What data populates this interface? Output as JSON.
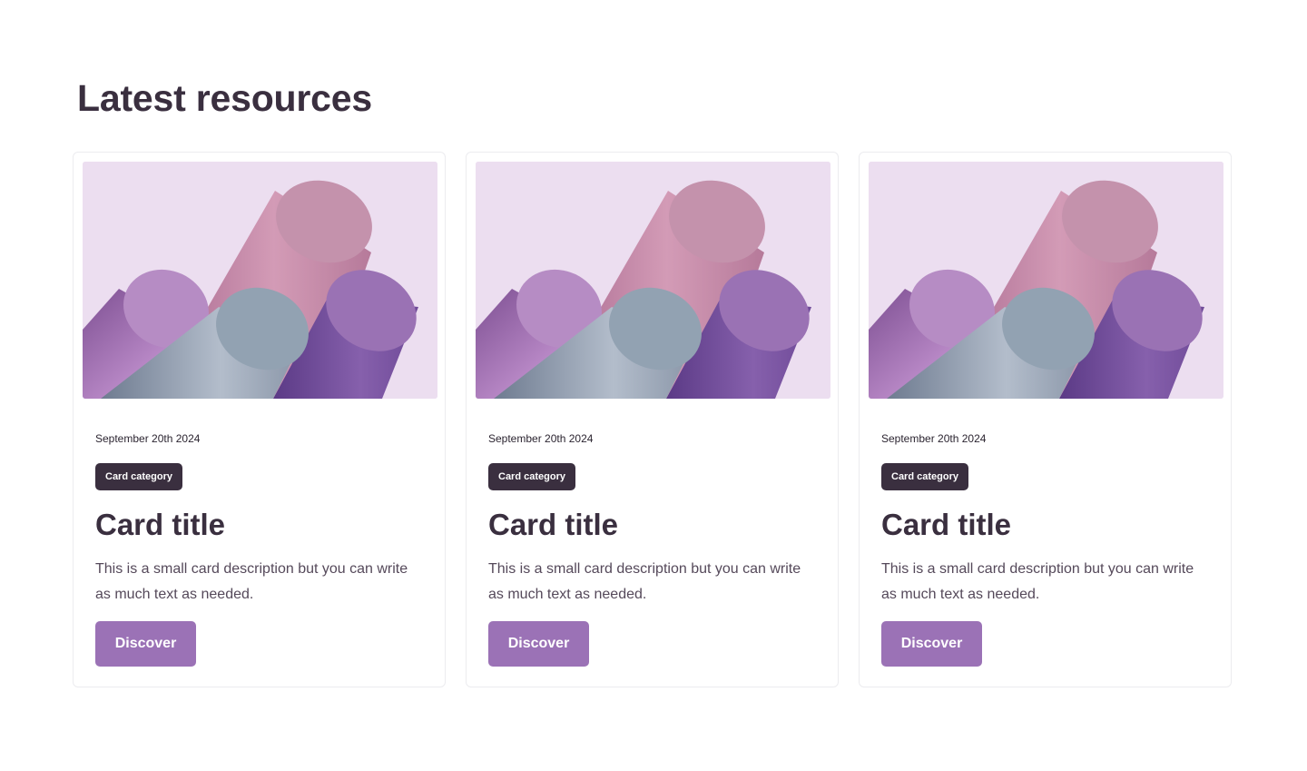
{
  "section": {
    "title": "Latest resources"
  },
  "cards": [
    {
      "date": "September 20th 2024",
      "category": "Card category",
      "title": "Card title",
      "description": "This is a small card description but you can write as much text as needed.",
      "button_label": "Discover"
    },
    {
      "date": "September 20th 2024",
      "category": "Card category",
      "title": "Card title",
      "description": "This is a small card description but you can write as much text as needed.",
      "button_label": "Discover"
    },
    {
      "date": "September 20th 2024",
      "category": "Card category",
      "title": "Card title",
      "description": "This is a small card description but you can write as much text as needed.",
      "button_label": "Discover"
    }
  ],
  "colors": {
    "heading": "#3a2f3f",
    "badge_bg": "#3a2f3f",
    "button_bg": "#9b72b6",
    "image_bg": "#ecdef0"
  },
  "icons": {
    "card_image": "abstract-cylinders-illustration"
  }
}
